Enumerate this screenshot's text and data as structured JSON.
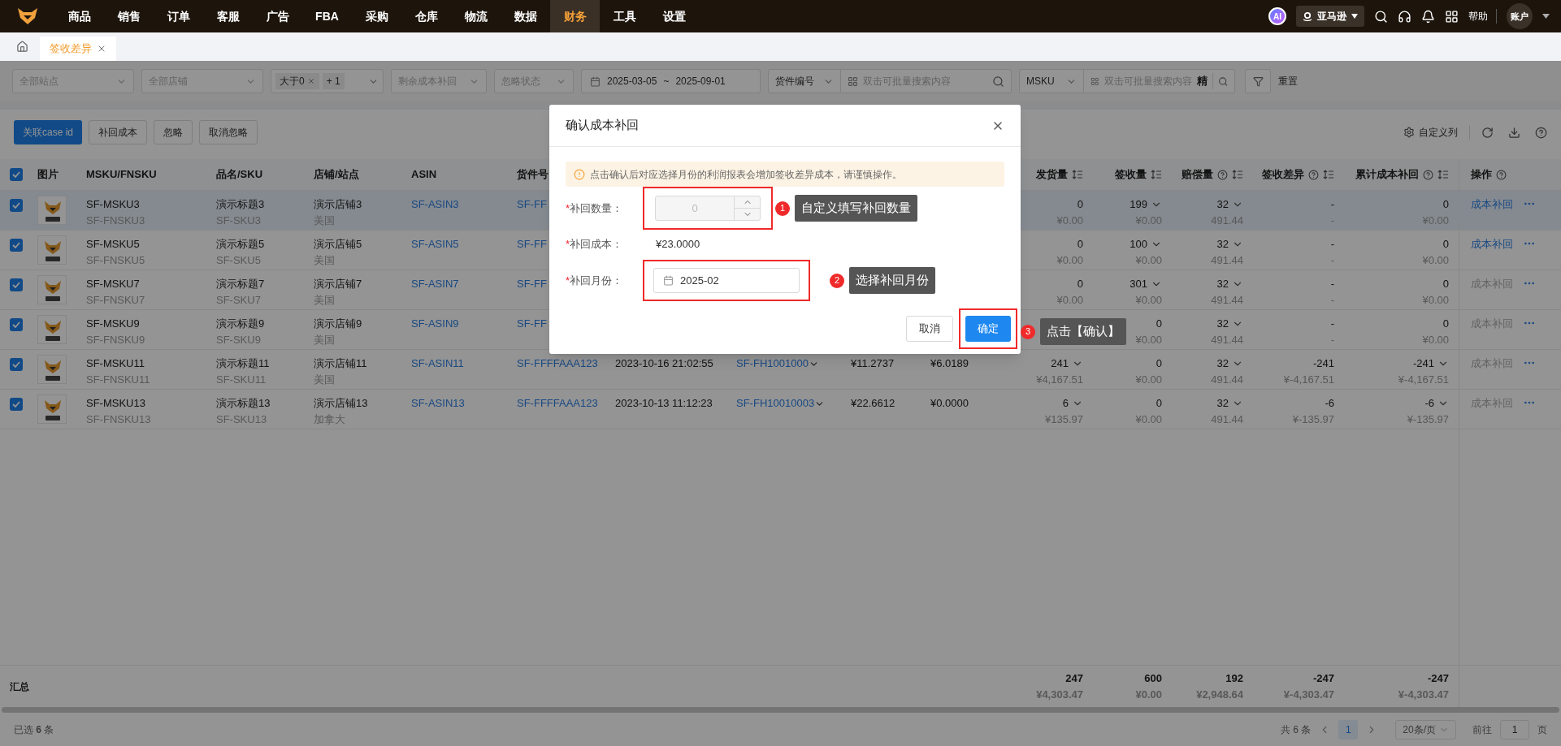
{
  "nav": {
    "items": [
      {
        "label": "商品",
        "selected": false
      },
      {
        "label": "销售",
        "selected": false
      },
      {
        "label": "订单",
        "selected": false
      },
      {
        "label": "客服",
        "selected": false
      },
      {
        "label": "广告",
        "selected": false
      },
      {
        "label": "FBA",
        "selected": false
      },
      {
        "label": "采购",
        "selected": false
      },
      {
        "label": "仓库",
        "selected": false
      },
      {
        "label": "物流",
        "selected": false
      },
      {
        "label": "数据",
        "selected": false
      },
      {
        "label": "财务",
        "selected": true
      },
      {
        "label": "工具",
        "selected": false
      },
      {
        "label": "设置",
        "selected": false
      }
    ],
    "ai_badge": "AI",
    "platform": "亚马逊",
    "help": "帮助",
    "account": "账户"
  },
  "tabs": [
    {
      "label": "签收差异",
      "selected": true
    }
  ],
  "filters": {
    "site": "全部站点",
    "store": "全部店铺",
    "tags": [
      "大于0",
      "+ 1"
    ],
    "remaining": "剩余成本补回",
    "ignore": "忽略状态",
    "date_from": "2025-03-05",
    "date_sep": "~",
    "date_to": "2025-09-01",
    "search_1": {
      "field": "货件编号",
      "placeholder": "双击可批量搜索内容"
    },
    "search_2": {
      "field": "MSKU",
      "placeholder": "双击可批量搜索内容",
      "exact": "精"
    },
    "reset": "重置"
  },
  "toolbar": {
    "buttons": [
      {
        "label": "关联case id",
        "primary": true
      },
      {
        "label": "补回成本",
        "primary": false
      },
      {
        "label": "忽略",
        "primary": false
      },
      {
        "label": "取消忽略",
        "primary": false
      }
    ],
    "custom_columns": "自定义列"
  },
  "table": {
    "all_checked": true,
    "columns_left": [
      "图片",
      "MSKU/FNSKU",
      "品名/SKU",
      "店铺/站点",
      "ASIN",
      "货件号"
    ],
    "columns_right": [
      {
        "label": "发货量",
        "sort": true,
        "help": false
      },
      {
        "label": "签收量",
        "sort": true,
        "help": false
      },
      {
        "label": "赔偿量",
        "sort": true,
        "help": true
      },
      {
        "label": "签收差异",
        "sort": true,
        "help": true
      },
      {
        "label": "累计成本补回",
        "sort": true,
        "help": true
      },
      {
        "label": "操作",
        "sort": false,
        "help": true
      }
    ],
    "rows": [
      {
        "checked": true,
        "highlighted": true,
        "msku": "SF-MSKU3",
        "fnsku": "SF-FNSKU3",
        "title": "演示标题3",
        "sku": "SF-SKU3",
        "store": "演示店铺3",
        "site": "美国",
        "asin": "SF-ASIN3",
        "shipment_no": "SF-FF",
        "shipped": {
          "value": "0",
          "amount": "¥0.00",
          "dropdown": false
        },
        "received": {
          "value": "199",
          "amount": "¥0.00",
          "dropdown": true
        },
        "compensation": {
          "value": "32",
          "amount": "491.44",
          "dropdown": true
        },
        "diff": {
          "value": "-",
          "amount": "-",
          "dropdown": false
        },
        "cumulative": {
          "value": "0",
          "amount": "¥0.00",
          "dropdown": false
        },
        "action": {
          "label": "成本补回",
          "enabled": true
        }
      },
      {
        "checked": true,
        "highlighted": false,
        "msku": "SF-MSKU5",
        "fnsku": "SF-FNSKU5",
        "title": "演示标题5",
        "sku": "SF-SKU5",
        "store": "演示店铺5",
        "site": "美国",
        "asin": "SF-ASIN5",
        "shipment_no": "SF-FF",
        "shipped": {
          "value": "0",
          "amount": "¥0.00",
          "dropdown": false
        },
        "received": {
          "value": "100",
          "amount": "¥0.00",
          "dropdown": true
        },
        "compensation": {
          "value": "32",
          "amount": "491.44",
          "dropdown": true
        },
        "diff": {
          "value": "-",
          "amount": "-",
          "dropdown": false
        },
        "cumulative": {
          "value": "0",
          "amount": "¥0.00",
          "dropdown": false
        },
        "action": {
          "label": "成本补回",
          "enabled": true
        }
      },
      {
        "checked": true,
        "highlighted": false,
        "msku": "SF-MSKU7",
        "fnsku": "SF-FNSKU7",
        "title": "演示标题7",
        "sku": "SF-SKU7",
        "store": "演示店铺7",
        "site": "美国",
        "asin": "SF-ASIN7",
        "shipment_no": "SF-FF",
        "shipped": {
          "value": "0",
          "amount": "¥0.00",
          "dropdown": false
        },
        "received": {
          "value": "301",
          "amount": "¥0.00",
          "dropdown": true
        },
        "compensation": {
          "value": "32",
          "amount": "491.44",
          "dropdown": true
        },
        "diff": {
          "value": "-",
          "amount": "-",
          "dropdown": false
        },
        "cumulative": {
          "value": "0",
          "amount": "¥0.00",
          "dropdown": false
        },
        "action": {
          "label": "成本补回",
          "enabled": false
        }
      },
      {
        "checked": true,
        "highlighted": false,
        "msku": "SF-MSKU9",
        "fnsku": "SF-FNSKU9",
        "title": "演示标题9",
        "sku": "SF-SKU9",
        "store": "演示店铺9",
        "site": "美国",
        "asin": "SF-ASIN9",
        "shipment_no": "SF-FF",
        "received": {
          "value": "0",
          "amount": "¥0.00",
          "dropdown": false
        },
        "compensation": {
          "value": "32",
          "amount": "491.44",
          "dropdown": true
        },
        "diff": {
          "value": "-",
          "amount": "-",
          "dropdown": false
        },
        "cumulative": {
          "value": "0",
          "amount": "¥0.00",
          "dropdown": false
        },
        "action": {
          "label": "成本补回",
          "enabled": false
        }
      },
      {
        "checked": true,
        "highlighted": false,
        "msku": "SF-MSKU11",
        "fnsku": "SF-FNSKU11",
        "title": "演示标题11",
        "sku": "SF-SKU11",
        "store": "演示店铺11",
        "site": "美国",
        "asin": "SF-ASIN11",
        "shipment_no": "SF-FFFFAAA123",
        "created": "2023-10-16 21:02:55",
        "shipment_id": "SF-FH1001000",
        "price_1": "¥11.2737",
        "price_2": "¥6.0189",
        "shipped": {
          "value": "241",
          "amount": "¥4,167.51",
          "dropdown": true
        },
        "received": {
          "value": "0",
          "amount": "¥0.00",
          "dropdown": false
        },
        "compensation": {
          "value": "32",
          "amount": "491.44",
          "dropdown": true
        },
        "diff": {
          "value": "-241",
          "amount": "¥-4,167.51",
          "dropdown": false
        },
        "cumulative": {
          "value": "-241",
          "amount": "¥-4,167.51",
          "dropdown": true
        },
        "action": {
          "label": "成本补回",
          "enabled": false
        }
      },
      {
        "checked": true,
        "highlighted": false,
        "msku": "SF-MSKU13",
        "fnsku": "SF-FNSKU13",
        "title": "演示标题13",
        "sku": "SF-SKU13",
        "store": "演示店铺13",
        "site": "加拿大",
        "asin": "SF-ASIN13",
        "shipment_no": "SF-FFFFAAA123",
        "created": "2023-10-13 11:12:23",
        "shipment_id": "SF-FH10010003",
        "price_1": "¥22.6612",
        "price_2": "¥0.0000",
        "shipped": {
          "value": "6",
          "amount": "¥135.97",
          "dropdown": true
        },
        "received": {
          "value": "0",
          "amount": "¥0.00",
          "dropdown": false
        },
        "compensation": {
          "value": "32",
          "amount": "491.44",
          "dropdown": true
        },
        "diff": {
          "value": "-6",
          "amount": "¥-135.97",
          "dropdown": false
        },
        "cumulative": {
          "value": "-6",
          "amount": "¥-135.97",
          "dropdown": true
        },
        "action": {
          "label": "成本补回",
          "enabled": false
        }
      }
    ],
    "summary": {
      "label": "汇总",
      "values": [
        {
          "value": "247",
          "amount": "¥4,303.47"
        },
        {
          "value": "600",
          "amount": "¥0.00"
        },
        {
          "value": "192",
          "amount": "¥2,948.64"
        },
        {
          "value": "-247",
          "amount": "¥-4,303.47"
        },
        {
          "value": "-247",
          "amount": "¥-4,303.47"
        }
      ]
    }
  },
  "footer": {
    "selected_text": "已选 **6** 条",
    "total": "共 6 条",
    "pages": [
      {
        "label": "1",
        "selected": true
      }
    ],
    "page_size": "20条/页",
    "goto_label": "前往",
    "goto_value": "1",
    "goto_unit": "页"
  },
  "dialog": {
    "title": "确认成本补回",
    "notice": "点击确认后对应选择月份的利润报表会增加签收差异成本，请谨慎操作。",
    "fields": [
      {
        "kind": "number",
        "mark": "*",
        "label": "补回数量：",
        "value": "0",
        "disabled": true,
        "boxed": true,
        "callout": {
          "step": "1",
          "text": "自定义填写补回数量"
        }
      },
      {
        "kind": "text",
        "mark": "*",
        "label": "补回成本：",
        "value": "¥23.0000",
        "boxed": false
      },
      {
        "kind": "month",
        "mark": "*",
        "label": "补回月份：",
        "value": "2025-02",
        "boxed": true,
        "callout": {
          "step": "2",
          "text": "选择补回月份"
        }
      }
    ],
    "buttons": [
      {
        "label": "取消",
        "primary": false,
        "boxed": false
      },
      {
        "label": "确定",
        "primary": true,
        "boxed": true,
        "callout": {
          "step": "3",
          "text": "点击【确认】"
        }
      }
    ]
  }
}
